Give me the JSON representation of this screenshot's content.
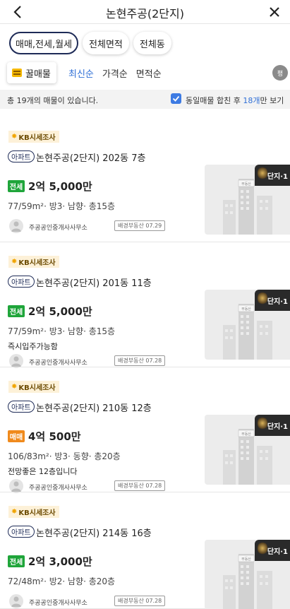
{
  "header": {
    "title": "논현주공(2단지)"
  },
  "filters": {
    "chips": [
      "매매,전세,월세",
      "전체면적",
      "전체동"
    ]
  },
  "sort": {
    "honey_label": "꿀매물",
    "options": [
      "최신순",
      "가격순",
      "면적순"
    ],
    "pyeong_label": "평"
  },
  "summary": {
    "total_text": "총 19개의 매물이 있습니다.",
    "merge_prefix": "동일매물 합친 후 ",
    "merge_count": "18개",
    "merge_suffix": "만 보기"
  },
  "colors": {
    "jeonse": "#1fa53a",
    "maemae": "#f08a1c",
    "accent": "#2f6fd6",
    "navy": "#1e2b57"
  },
  "listings": [
    {
      "badge": "KB시세조사",
      "type": "아파트",
      "name": "논현주공(2단지) 202동 7층",
      "deal": "전세",
      "deal_color": "#1fa53a",
      "price": "2억 5,000만",
      "spec": "77/59m²· 방3· 남향· 총15층",
      "desc": "",
      "agent": "주공공인중개사사무소",
      "source": "배경부동산",
      "date": "07.29",
      "thumb_label": "단지·1",
      "sign": "부동산"
    },
    {
      "badge": "KB시세조사",
      "type": "아파트",
      "name": "논현주공(2단지) 201동 11층",
      "deal": "전세",
      "deal_color": "#1fa53a",
      "price": "2억 5,000만",
      "spec": "77/59m²· 방3· 남향· 총15층",
      "desc": "즉시입주가능함",
      "agent": "주공공인중개사사무소",
      "source": "배경부동산",
      "date": "07.28",
      "thumb_label": "단지·1",
      "sign": "부동산"
    },
    {
      "badge": "KB시세조사",
      "type": "아파트",
      "name": "논현주공(2단지) 210동 12층",
      "deal": "매매",
      "deal_color": "#f08a1c",
      "price": "4억 500만",
      "spec": "106/83m²· 방3· 동향· 총20층",
      "desc": "전망좋은 12층입니다",
      "agent": "주공공인중개사사무소",
      "source": "배경부동산",
      "date": "07.28",
      "thumb_label": "단지·1",
      "sign": "부동산"
    },
    {
      "badge": "KB시세조사",
      "type": "아파트",
      "name": "논현주공(2단지) 214동 16층",
      "deal": "전세",
      "deal_color": "#1fa53a",
      "price": "2억 3,000만",
      "spec": "72/48m²· 방2· 남향· 총20층",
      "desc": "",
      "agent": "주공공인중개사사무소",
      "source": "배경부동산",
      "date": "07.28",
      "thumb_label": "단지·1",
      "sign": "부동산"
    }
  ]
}
